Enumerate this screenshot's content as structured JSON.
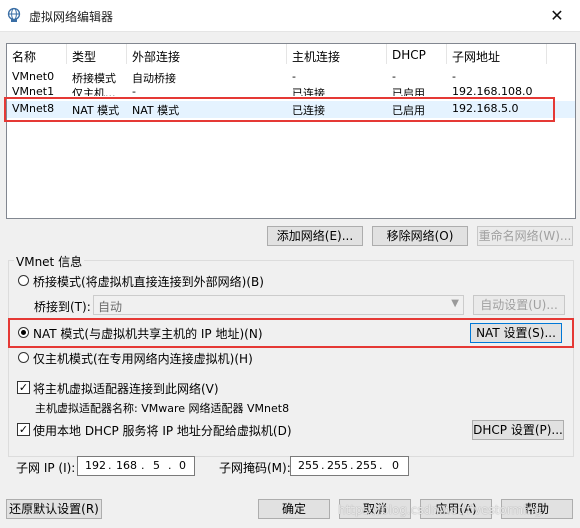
{
  "window": {
    "title": "虚拟网络编辑器",
    "close_glyph": "✕",
    "app_icon": "network-globe-icon"
  },
  "network_list": {
    "columns": [
      "名称",
      "类型",
      "外部连接",
      "主机连接",
      "DHCP",
      "子网地址"
    ],
    "rows": [
      {
        "name": "VMnet0",
        "type": "桥接模式",
        "external": "自动桥接",
        "host": "-",
        "dhcp": "-",
        "subnet": "-"
      },
      {
        "name": "VMnet1",
        "type": "仅主机...",
        "external": "-",
        "host": "已连接",
        "dhcp": "已启用",
        "subnet": "192.168.108.0"
      },
      {
        "name": "VMnet8",
        "type": "NAT 模式",
        "external": "NAT 模式",
        "host": "已连接",
        "dhcp": "已启用",
        "subnet": "192.168.5.0"
      }
    ],
    "selected_index": 2
  },
  "list_buttons": {
    "add": "添加网络(E)...",
    "remove": "移除网络(O)",
    "rename": "重命名网络(W)..."
  },
  "vmnet_info": {
    "title": "VMnet 信息",
    "bridge_radio": "桥接模式(将虚拟机直接连接到外部网络)(B)",
    "bridge_to_label": "桥接到(T):",
    "bridge_to_value": "自动",
    "auto_settings": "自动设置(U)...",
    "nat_radio": "NAT 模式(与虚拟机共享主机的 IP 地址)(N)",
    "nat_settings": "NAT 设置(S)...",
    "host_only_radio": "仅主机模式(在专用网络内连接虚拟机)(H)",
    "connect_adapter": "将主机虚拟适配器连接到此网络(V)",
    "adapter_name": "主机虚拟适配器名称: VMware 网络适配器 VMnet8",
    "use_dhcp": "使用本地 DHCP 服务将 IP 地址分配给虚拟机(D)",
    "dhcp_settings": "DHCP 设置(P)...",
    "subnet_ip_label": "子网 IP (I):",
    "subnet_ip": [
      "192",
      "168",
      "5",
      "0"
    ],
    "subnet_mask_label": "子网掩码(M):",
    "subnet_mask": [
      "255",
      "255",
      "255",
      "0"
    ],
    "ip_dot": "."
  },
  "footer": {
    "restore": "还原默认设置(R)",
    "ok": "确定",
    "cancel": "取消",
    "apply": "应用(A)",
    "help": "帮助"
  },
  "watermark": "https://blog.csdn.net/fivestorming",
  "colors": {
    "highlight_border": "#e53935",
    "selection": "#e5f3ff",
    "accent": "#0078d7"
  }
}
